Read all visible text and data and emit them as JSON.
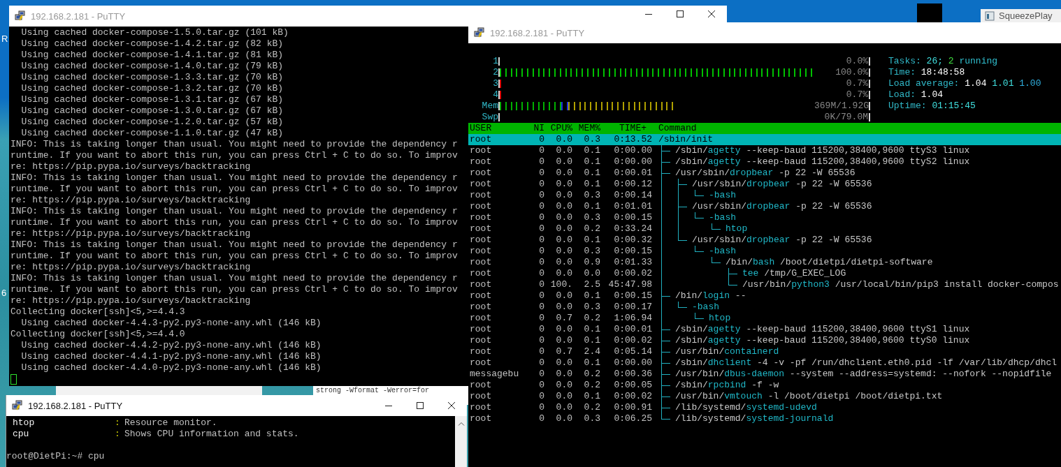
{
  "desktop": {
    "icon_labels": [
      "R",
      "6"
    ]
  },
  "background_windows": {
    "text": "strong -Wformat -Werror=for"
  },
  "squeezeplay_window": {
    "title": "SqueezePlay"
  },
  "install_terminal": {
    "title": "192.168.2.181 - PuTTY",
    "active": false,
    "lines": [
      "  Using cached docker-compose-1.5.0.tar.gz (101 kB)",
      "  Using cached docker-compose-1.4.2.tar.gz (82 kB)",
      "  Using cached docker-compose-1.4.1.tar.gz (81 kB)",
      "  Using cached docker-compose-1.4.0.tar.gz (79 kB)",
      "  Using cached docker-compose-1.3.3.tar.gz (70 kB)",
      "  Using cached docker-compose-1.3.2.tar.gz (70 kB)",
      "  Using cached docker-compose-1.3.1.tar.gz (67 kB)",
      "  Using cached docker-compose-1.3.0.tar.gz (67 kB)",
      "  Using cached docker-compose-1.2.0.tar.gz (57 kB)",
      "  Using cached docker-compose-1.1.0.tar.gz (47 kB)",
      "INFO: This is taking longer than usual. You might need to provide the dependency r",
      "runtime. If you want to abort this run, you can press Ctrl + C to do so. To improv",
      "re: https://pip.pypa.io/surveys/backtracking",
      "INFO: This is taking longer than usual. You might need to provide the dependency r",
      "runtime. If you want to abort this run, you can press Ctrl + C to do so. To improv",
      "re: https://pip.pypa.io/surveys/backtracking",
      "INFO: This is taking longer than usual. You might need to provide the dependency r",
      "runtime. If you want to abort this run, you can press Ctrl + C to do so. To improv",
      "re: https://pip.pypa.io/surveys/backtracking",
      "INFO: This is taking longer than usual. You might need to provide the dependency r",
      "runtime. If you want to abort this run, you can press Ctrl + C to do so. To improv",
      "re: https://pip.pypa.io/surveys/backtracking",
      "INFO: This is taking longer than usual. You might need to provide the dependency r",
      "runtime. If you want to abort this run, you can press Ctrl + C to do so. To improv",
      "re: https://pip.pypa.io/surveys/backtracking",
      "Collecting docker[ssh]<5,>=4.4.3",
      "  Using cached docker-4.4.3-py2.py3-none-any.whl (146 kB)",
      "Collecting docker[ssh]<5,>=4.4.0",
      "  Using cached docker-4.4.2-py2.py3-none-any.whl (146 kB)",
      "  Using cached docker-4.4.1-py2.py3-none-any.whl (146 kB)",
      "  Using cached docker-4.4.0-py2.py3-none-any.whl (146 kB)"
    ]
  },
  "htop_terminal": {
    "title": "192.168.2.181 - PuTTY",
    "active": false,
    "meters": [
      {
        "kind": "bar",
        "label": "1",
        "reading": "0.0%"
      },
      {
        "kind": "bar",
        "label": "2",
        "level": 1,
        "color": "#00c000",
        "reading": "100.0%"
      },
      {
        "kind": "bar",
        "label": "3",
        "level": 0.007,
        "color": "#e00000",
        "reading": "0.7%"
      },
      {
        "kind": "bar",
        "label": "4",
        "level": 0.007,
        "color": "#e00000",
        "reading": "0.7%"
      },
      {
        "kind": "segmented",
        "label": "Mem",
        "segments": [
          {
            "level": 0.195,
            "color": "#00b000"
          },
          {
            "level": 0.022,
            "color": "#2030e0"
          },
          {
            "level": 0.34,
            "color": "#b0a000"
          }
        ],
        "reading": "369M/1.92G"
      },
      {
        "kind": "bar",
        "label": "Swp",
        "reading": "0K/79.0M"
      }
    ],
    "stats": [
      {
        "label": "Tasks:",
        "values": [
          {
            "text": "26;",
            "color": "#40e0e0"
          },
          {
            "text": "2",
            "color": "#40e040"
          },
          {
            "text": "running",
            "color": "#30c0d0"
          }
        ]
      },
      {
        "label": "Time:",
        "values": [
          {
            "text": "18:48:58",
            "color": "#ffffff"
          }
        ]
      },
      {
        "label": "Load average:",
        "values": [
          {
            "text": "1.04",
            "color": "#ffffff"
          },
          {
            "text": "1.01",
            "color": "#40e0e0"
          },
          {
            "text": "1.00",
            "color": "#30b0e0"
          }
        ]
      },
      {
        "label": "Load:",
        "values": [
          {
            "text": "1.04",
            "color": "#ffffff"
          }
        ]
      },
      {
        "label": "Uptime:",
        "values": [
          {
            "text": "01:15:45",
            "color": "#40e0e0"
          }
        ]
      }
    ],
    "columns": [
      "USER",
      "NI",
      "CPU%",
      "MEM%",
      "TIME+",
      "Command"
    ],
    "processes": [
      {
        "user": "root",
        "ni": "0",
        "cpu": "0.0",
        "mem": "0.3",
        "time": "0:13.52",
        "path": "/sbin/",
        "program": "init",
        "selected": true,
        "children": [
          {
            "user": "root",
            "ni": "0",
            "cpu": "0.0",
            "mem": "0.1",
            "time": "0:00.00",
            "path": "/sbin/",
            "program": "agetty",
            "args": "--keep-baud 115200,38400,9600 ttyS3 linux",
            "selected": false
          },
          {
            "user": "root",
            "ni": "0",
            "cpu": "0.0",
            "mem": "0.1",
            "time": "0:00.00",
            "path": "/sbin/",
            "program": "agetty",
            "args": "--keep-baud 115200,38400,9600 ttyS2 linux",
            "selected": false
          },
          {
            "user": "root",
            "ni": "0",
            "cpu": "0.0",
            "mem": "0.1",
            "time": "0:00.01",
            "path": "/usr/sbin/",
            "program": "dropbear",
            "args": "-p 22 -W 65536",
            "selected": false,
            "children": [
              {
                "user": "root",
                "ni": "0",
                "cpu": "0.0",
                "mem": "0.1",
                "time": "0:00.12",
                "path": "/usr/sbin/",
                "program": "dropbear",
                "args": "-p 22 -W 65536",
                "selected": false,
                "children": [
                  {
                    "user": "root",
                    "ni": "0",
                    "cpu": "0.0",
                    "mem": "0.3",
                    "time": "0:00.14",
                    "program": "-bash",
                    "selected": false
                  }
                ]
              },
              {
                "user": "root",
                "ni": "0",
                "cpu": "0.0",
                "mem": "0.1",
                "time": "0:01.01",
                "path": "/usr/sbin/",
                "program": "dropbear",
                "args": "-p 22 -W 65536",
                "selected": false,
                "children": [
                  {
                    "user": "root",
                    "ni": "0",
                    "cpu": "0.0",
                    "mem": "0.3",
                    "time": "0:00.15",
                    "program": "-bash",
                    "selected": false,
                    "children": [
                      {
                        "user": "root",
                        "ni": "0",
                        "cpu": "0.0",
                        "mem": "0.2",
                        "time": "0:33.24",
                        "program": "htop",
                        "selected": false
                      }
                    ]
                  }
                ]
              },
              {
                "user": "root",
                "ni": "0",
                "cpu": "0.0",
                "mem": "0.1",
                "time": "0:00.32",
                "path": "/usr/sbin/",
                "program": "dropbear",
                "args": "-p 22 -W 65536",
                "selected": false,
                "children": [
                  {
                    "user": "root",
                    "ni": "0",
                    "cpu": "0.0",
                    "mem": "0.3",
                    "time": "0:00.15",
                    "program": "-bash",
                    "selected": false,
                    "children": [
                      {
                        "user": "root",
                        "ni": "0",
                        "cpu": "0.0",
                        "mem": "0.9",
                        "time": "0:01.33",
                        "path": "/bin/",
                        "program": "bash",
                        "args": "/boot/dietpi/dietpi-software",
                        "selected": false,
                        "children": [
                          {
                            "user": "root",
                            "ni": "0",
                            "cpu": "0.0",
                            "mem": "0.0",
                            "time": "0:00.02",
                            "program": "tee",
                            "args": "/tmp/G_EXEC_LOG",
                            "selected": false
                          },
                          {
                            "user": "root",
                            "ni": "0",
                            "cpu": "100.",
                            "mem": "2.5",
                            "time": "45:47.98",
                            "path": "/usr/bin/",
                            "program": "python3",
                            "args": "/usr/local/bin/pip3 install docker-compos",
                            "selected": false
                          }
                        ]
                      }
                    ]
                  }
                ]
              }
            ]
          },
          {
            "user": "root",
            "ni": "0",
            "cpu": "0.0",
            "mem": "0.1",
            "time": "0:00.15",
            "path": "/bin/",
            "program": "login",
            "args": "--",
            "selected": false,
            "children": [
              {
                "user": "root",
                "ni": "0",
                "cpu": "0.0",
                "mem": "0.3",
                "time": "0:00.17",
                "program": "-bash",
                "selected": false,
                "children": [
                  {
                    "user": "root",
                    "ni": "0",
                    "cpu": "0.7",
                    "mem": "0.2",
                    "time": "1:06.94",
                    "program": "htop",
                    "selected": false
                  }
                ]
              }
            ]
          },
          {
            "user": "root",
            "ni": "0",
            "cpu": "0.0",
            "mem": "0.1",
            "time": "0:00.01",
            "path": "/sbin/",
            "program": "agetty",
            "args": "--keep-baud 115200,38400,9600 ttyS1 linux",
            "selected": false
          },
          {
            "user": "root",
            "ni": "0",
            "cpu": "0.0",
            "mem": "0.1",
            "time": "0:00.02",
            "path": "/sbin/",
            "program": "agetty",
            "args": "--keep-baud 115200,38400,9600 ttyS0 linux",
            "selected": false
          },
          {
            "user": "root",
            "ni": "0",
            "cpu": "0.7",
            "mem": "2.4",
            "time": "0:05.14",
            "path": "/usr/bin/",
            "program": "containerd",
            "selected": false
          },
          {
            "user": "root",
            "ni": "0",
            "cpu": "0.0",
            "mem": "0.1",
            "time": "0:00.00",
            "path": "/sbin/",
            "program": "dhclient",
            "args": "-4 -v -pf /run/dhclient.eth0.pid -lf /var/lib/dhcp/dhcl",
            "selected": false
          },
          {
            "user": "messagebu",
            "ni": "0",
            "cpu": "0.0",
            "mem": "0.2",
            "time": "0:00.36",
            "path": "/usr/bin/",
            "program": "dbus-daemon",
            "args": "--system --address=systemd: --nofork --nopidfile",
            "selected": false
          },
          {
            "user": "root",
            "ni": "0",
            "cpu": "0.0",
            "mem": "0.2",
            "time": "0:00.05",
            "path": "/sbin/",
            "program": "rpcbind",
            "args": "-f -w",
            "selected": false
          },
          {
            "user": "root",
            "ni": "0",
            "cpu": "0.0",
            "mem": "0.1",
            "time": "0:00.02",
            "path": "/usr/bin/",
            "program": "vmtouch",
            "args": "-l /boot/dietpi /boot/dietpi.txt",
            "selected": false
          },
          {
            "user": "root",
            "ni": "0",
            "cpu": "0.0",
            "mem": "0.2",
            "time": "0:00.91",
            "path": "/lib/systemd/",
            "program": "systemd-udevd",
            "selected": false
          },
          {
            "user": "root",
            "ni": "0",
            "cpu": "0.0",
            "mem": "0.3",
            "time": "0:06.25",
            "path": "/lib/systemd/",
            "program": "systemd-journald",
            "selected": false
          }
        ]
      }
    ]
  },
  "menu_terminal": {
    "title": "192.168.2.181 - PuTTY",
    "active": true,
    "entries": [
      {
        "name": "htop",
        "separator": ":",
        "description": "Resource monitor."
      },
      {
        "name": "cpu",
        "separator": ":",
        "description": "Shows CPU information and stats."
      }
    ],
    "prompt": "root@DietPi:~# cpu"
  }
}
